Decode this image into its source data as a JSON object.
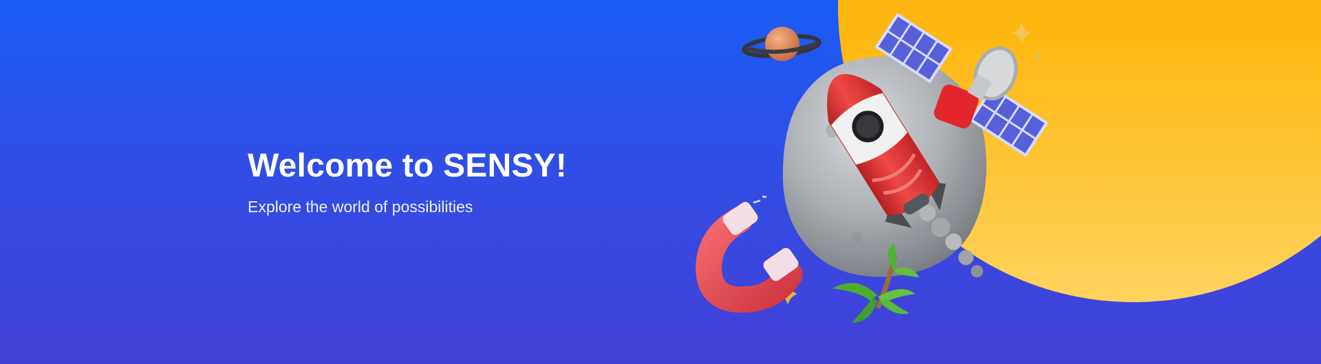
{
  "hero": {
    "title": "Welcome to SENSY!",
    "subtitle": "Explore the world of possibilities"
  },
  "illustration": {
    "icons": [
      "planet-icon",
      "asteroid-icon",
      "rocket-icon",
      "satellite-icon",
      "magnet-icon",
      "palm-icon",
      "sparkle-icon"
    ]
  },
  "colors": {
    "background_top": "#1a5cf5",
    "background_bottom": "#4440d6",
    "sun": "#ffb000",
    "rocket": "#e33a3a",
    "asteroid": "#a7abb1",
    "magnet": "#ea4f58",
    "planet": "#dc8a55",
    "palm": "#58b83b",
    "sparkle": "#f0c85a"
  }
}
